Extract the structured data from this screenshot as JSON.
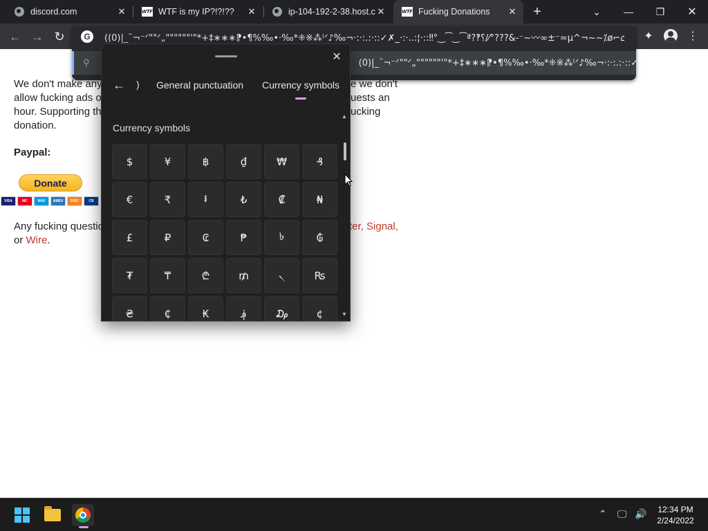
{
  "browser": {
    "tabs": [
      {
        "title": "discord.com",
        "favicon": "globe-icon"
      },
      {
        "title": "WTF is my IP?!?!??",
        "favicon": "wtf-icon"
      },
      {
        "title": "ip-104-192-2-38.host.c",
        "favicon": "globe-icon"
      },
      {
        "title": "Fucking Donations",
        "favicon": "wtf-icon",
        "active": true
      }
    ],
    "omnibox_text": "((0)|_¨¬⁻ᐟ\"\"ᐟ„\"\"\"\"\"\"'\"*+‡∗∗∗⁋•¶%‰•·‰*⁜※⁂⁽ᐟ♪‰¬·:·:.:·::✓✗_·:·..:¦·::‼°‿⁀‿⁀ª?‽⸮/⁄°???&-⁻~〰∞±⁻≃µ^¬~~⁒ø⌐⌂",
    "suggestion_text": "(0)|_¨¬⁻ᐟ\"\"ᐟ„\"\"\"\"\"\"'\"*+‡∗∗∗⁋•¶%‰•·‰*⁜※⁂⁽ᐟ♪‰¬·:·:.:·::✓✗_..."
  },
  "page": {
    "para_lines": [
      "We don't make any",
      "allow fucking ads o",
      "hour. Supporting th",
      "donation."
    ],
    "para_right": [
      "e we don't",
      "uests an",
      "ucking"
    ],
    "paypal_label": "Paypal:",
    "donate_label": "Donate",
    "cards": [
      "VISA",
      "MC",
      "MAE",
      "AMEX",
      "DISC",
      "CB"
    ],
    "contact_start": "Any fucking questio",
    "contact_links_right": "ter, Signal,",
    "contact_line2_prefix": "or ",
    "contact_link_wire": "Wire",
    "contact_line2_suffix": "."
  },
  "emoji_panel": {
    "tab_partial": ")",
    "tabs": [
      "General punctuation",
      "Currency symbols"
    ],
    "section_title": "Currency symbols",
    "symbols": [
      "$",
      "¥",
      "฿",
      "₫",
      "₩",
      "₰",
      "€",
      "₹",
      "៛",
      "₺",
      "₡",
      "₦",
      "£",
      "₽",
      "₢",
      "₱",
      "৳",
      "₲",
      "₮",
      "₸",
      "₾",
      "₥",
      "৲",
      "₨",
      "₴",
      "₵",
      "₭",
      "؋",
      "₯",
      "¢"
    ]
  },
  "taskbar": {
    "time": "12:34 PM",
    "date": "2/24/2022"
  },
  "colors": {
    "link": "#c0392b",
    "accent": "#d8a0e8"
  }
}
